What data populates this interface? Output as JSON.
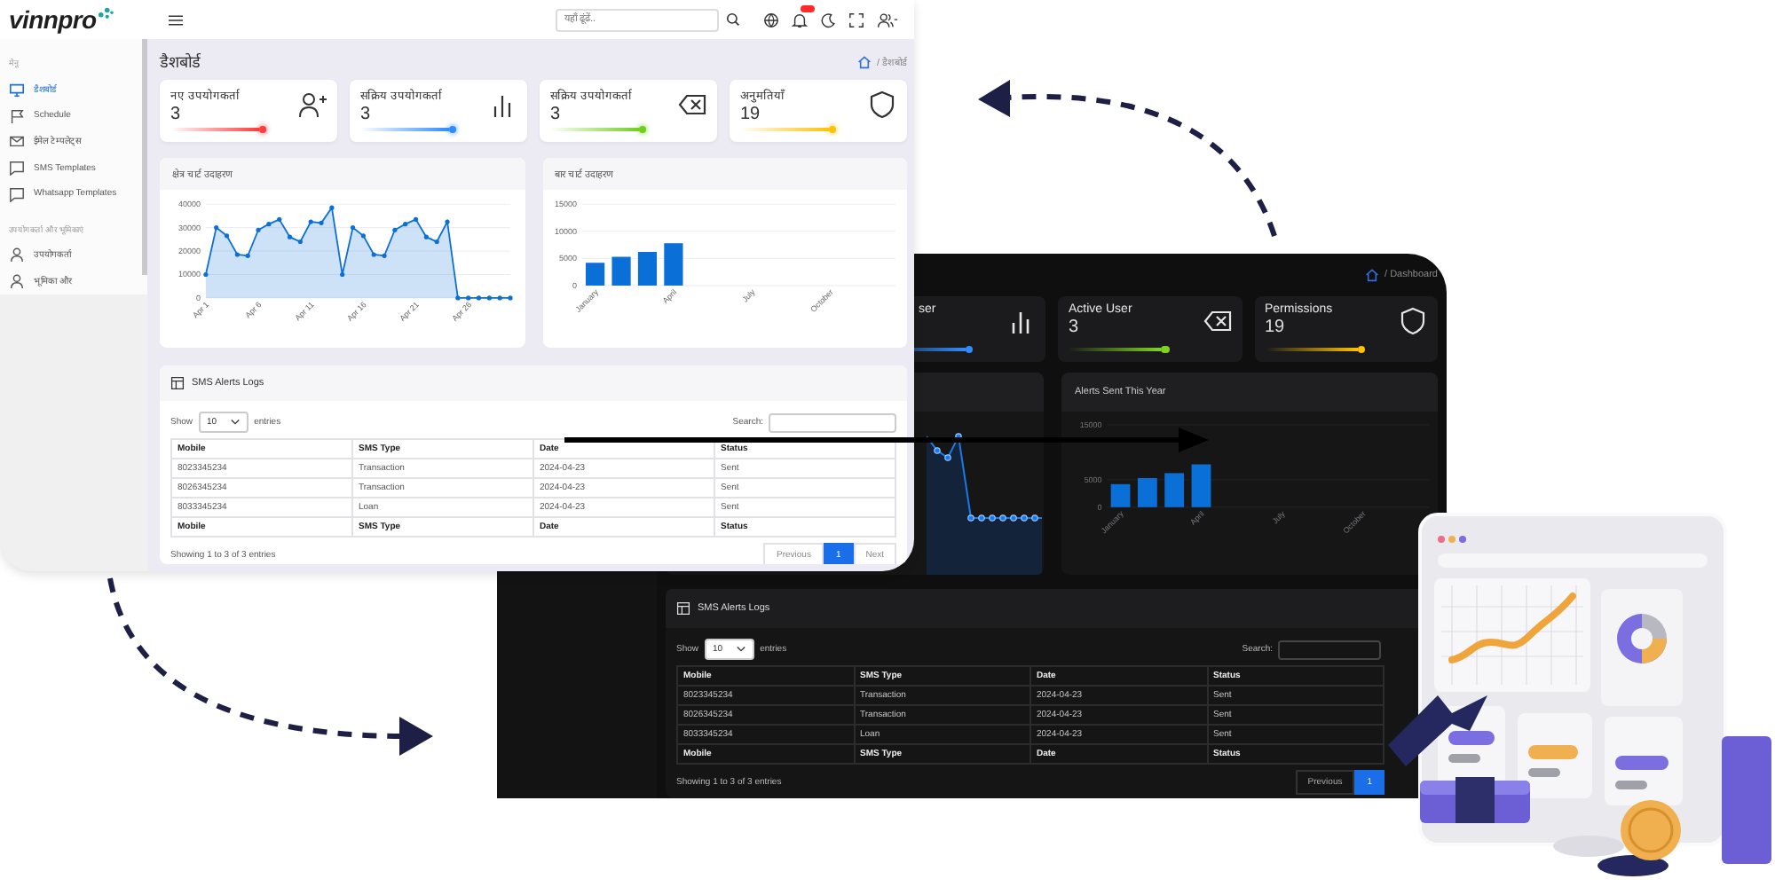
{
  "light": {
    "logo": "vinnpro",
    "search": {
      "placeholder": "यहाँ ढूंढें.."
    },
    "sidebar": {
      "sections": [
        {
          "title": "मेनू",
          "items": [
            {
              "label": "डैशबोर्ड",
              "selected": true
            },
            {
              "label": "Schedule",
              "selected": false
            },
            {
              "label": "ईमेल टेम्पलेट्स",
              "selected": false
            },
            {
              "label": "SMS Templates",
              "selected": false
            },
            {
              "label": "Whatsapp Templates",
              "selected": false
            }
          ]
        },
        {
          "title": "उपयोगकर्ता और भूमिकाएं",
          "items": [
            {
              "label": "उपयोगकर्ता",
              "selected": false
            },
            {
              "label": "भूमिका और",
              "selected": false
            }
          ]
        }
      ]
    },
    "page_title": "डैशबोर्ड",
    "breadcrumb": "/ डैशबोर्ड",
    "stats": [
      {
        "label": "नए उपयोगकर्ता",
        "value": "3",
        "color": "#ff3b3b"
      },
      {
        "label": "सक्रिय उपयोगकर्ता",
        "value": "3",
        "color": "#2f8cff"
      },
      {
        "label": "सक्रिय उपयोगकर्ता",
        "value": "3",
        "color": "#6fcf1f"
      },
      {
        "label": "अनुमतियाँ",
        "value": "19",
        "color": "#ffc107"
      }
    ],
    "charts": [
      {
        "chart_data": {
          "type": "area",
          "title": "क्षेत्र चार्ट उदाहरण",
          "grid": true,
          "categories": [
            "Apr 1",
            null,
            null,
            null,
            null,
            "Apr 6",
            null,
            null,
            null,
            null,
            "Apr 11",
            null,
            null,
            null,
            null,
            "Apr 16",
            null,
            null,
            null,
            null,
            "Apr 21",
            null,
            null,
            null,
            null,
            "Apr 26",
            null,
            null,
            null,
            null
          ],
          "ylim": [
            0,
            40000
          ],
          "yticks": [
            0,
            10000,
            20000,
            30000,
            40000
          ],
          "series": [
            {
              "color": "#0b6fd8",
              "values": [
                10000,
                30000,
                26500,
                18500,
                18000,
                29000,
                31500,
                33500,
                26000,
                24000,
                32500,
                32000,
                38500,
                10000,
                30000,
                26500,
                18500,
                18000,
                29000,
                31500,
                33500,
                26000,
                24000,
                32500,
                0,
                0,
                0,
                0,
                0,
                0
              ]
            }
          ]
        }
      },
      {
        "chart_data": {
          "type": "bar",
          "title": "बार चार्ट उदाहरण",
          "grid": true,
          "categories": [
            "January",
            null,
            null,
            "April",
            null,
            null,
            "July",
            null,
            null,
            "October",
            null,
            null
          ],
          "ylim": [
            0,
            15000
          ],
          "yticks": [
            0,
            5000,
            10000,
            15000
          ],
          "series": [
            {
              "color": "#0b6fd8",
              "values": [
                4200,
                5300,
                6200,
                7800,
                null,
                null,
                null,
                null,
                null,
                null,
                null,
                null
              ]
            }
          ]
        }
      }
    ],
    "table": {
      "title": "SMS Alerts Logs",
      "show": "Show",
      "page_size": "10",
      "entries": "entries",
      "search_label": "Search:",
      "columns": [
        "Mobile",
        "SMS Type",
        "Date",
        "Status"
      ],
      "rows": [
        [
          "8023345234",
          "Transaction",
          "2024-04-23",
          "Sent"
        ],
        [
          "8026345234",
          "Transaction",
          "2024-04-23",
          "Sent"
        ],
        [
          "8033345234",
          "Loan",
          "2024-04-23",
          "Sent"
        ]
      ],
      "footer": [
        "Mobile",
        "SMS Type",
        "Date",
        "Status"
      ],
      "info": "Showing 1 to 3 of 3 entries",
      "pages": [
        {
          "label": "Previous",
          "selected": false
        },
        {
          "label": "1",
          "selected": true
        },
        {
          "label": "Next",
          "selected": false
        }
      ]
    }
  },
  "dark": {
    "breadcrumb": "/ Dashboard",
    "stats": [
      {
        "label": "ser",
        "color": "#2f8cff"
      },
      {
        "label": "Active User",
        "value": "3",
        "color": "#7ed321"
      },
      {
        "label": "Permissions",
        "value": "19",
        "color": "#ffc107"
      }
    ],
    "chart": {
      "chart_data": {
        "type": "bar",
        "title": "Alerts Sent This Year",
        "grid": true,
        "categories": [
          "January",
          null,
          null,
          "April",
          null,
          null,
          "July",
          null,
          null,
          "October",
          null,
          null
        ],
        "ylim": [
          0,
          15000
        ],
        "yticks": [
          0,
          5000,
          15000
        ],
        "series": [
          {
            "color": "#0b6fd8",
            "values": [
              4200,
              5300,
              6200,
              7800,
              null,
              null,
              null,
              null,
              null,
              null,
              null,
              null
            ]
          }
        ]
      }
    },
    "table": {
      "title": "SMS Alerts Logs",
      "show": "Show",
      "page_size": "10",
      "entries": "entries",
      "search_label": "Search:",
      "columns": [
        "Mobile",
        "SMS Type",
        "Date",
        "Status"
      ],
      "rows": [
        [
          "8023345234",
          "Transaction",
          "2024-04-23",
          "Sent"
        ],
        [
          "8026345234",
          "Transaction",
          "2024-04-23",
          "Sent"
        ],
        [
          "8033345234",
          "Loan",
          "2024-04-23",
          "Sent"
        ]
      ],
      "footer": [
        "Mobile",
        "SMS Type",
        "Date",
        "Status"
      ],
      "info": "Showing 1 to 3 of 3 entries",
      "pages": [
        {
          "label": "Previous",
          "selected": false
        },
        {
          "label": "1",
          "selected": true
        }
      ]
    }
  }
}
